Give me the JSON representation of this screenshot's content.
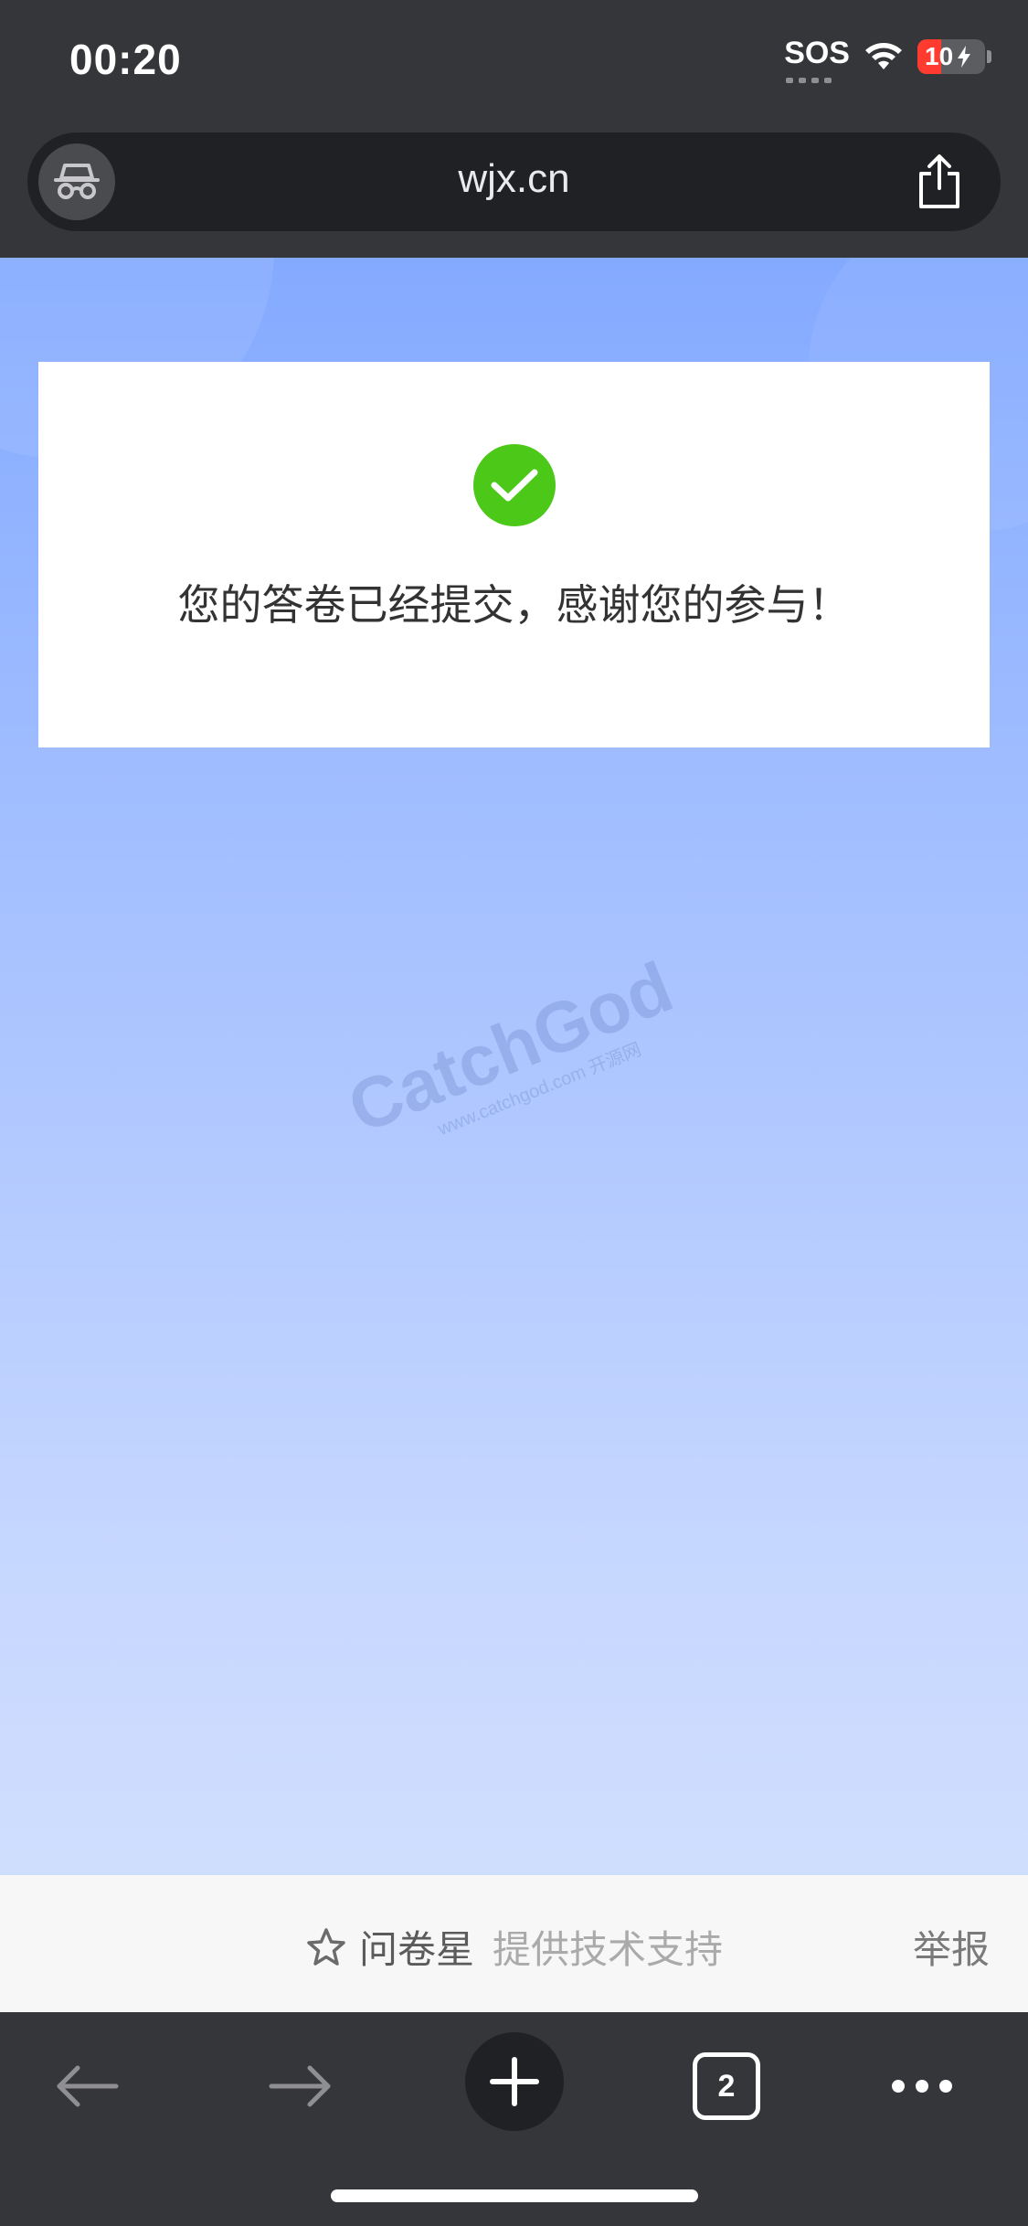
{
  "status_bar": {
    "time": "00:20",
    "sos": "SOS",
    "battery": {
      "text": "10",
      "level": 0.1,
      "charging": true,
      "color": "#ff3b30"
    },
    "icons": [
      "sos-icon",
      "wifi-icon",
      "battery-icon"
    ]
  },
  "browser": {
    "url": "wjx.cn",
    "incognito_icon": "incognito-icon",
    "share_icon": "share-icon"
  },
  "page": {
    "message": "您的答卷已经提交，感谢您的参与！",
    "success_color": "#4bc818",
    "watermark": {
      "main": "CatchGod",
      "sub": "www.catchgod.com 开源网"
    }
  },
  "footer": {
    "brand_name": "问卷星",
    "brand_desc": "提供技术支持",
    "report": "举报"
  },
  "toolbar": {
    "tabs_count": "2",
    "icons": [
      "back-arrow-icon",
      "forward-arrow-icon",
      "plus-icon",
      "tabs-icon",
      "more-icon"
    ]
  }
}
